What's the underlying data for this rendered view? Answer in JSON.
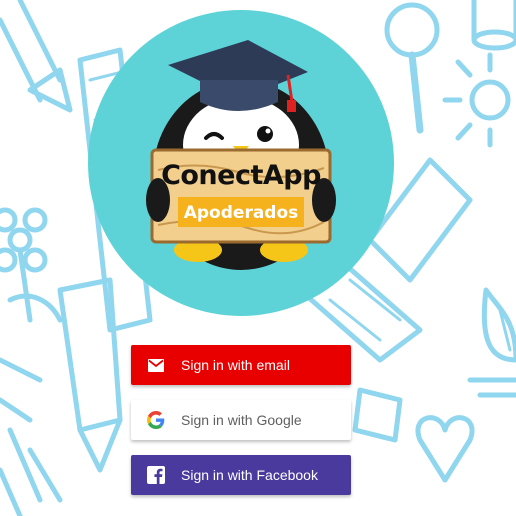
{
  "logo": {
    "title": "ConectApp",
    "subtitle": "Apoderados",
    "circle_color": "#5dd3d8",
    "mascot": "penguin-with-graduation-cap"
  },
  "background": {
    "pattern": "hand-drawn school doodles",
    "doodle_color": "#8fd6ee"
  },
  "auth_buttons": [
    {
      "label": "Sign in with email",
      "icon": "email-icon",
      "bg": "#e80000"
    },
    {
      "label": "Sign in with Google",
      "icon": "google-icon",
      "bg": "#ffffff"
    },
    {
      "label": "Sign in with Facebook",
      "icon": "facebook-icon",
      "bg": "#4b3a9e"
    }
  ]
}
